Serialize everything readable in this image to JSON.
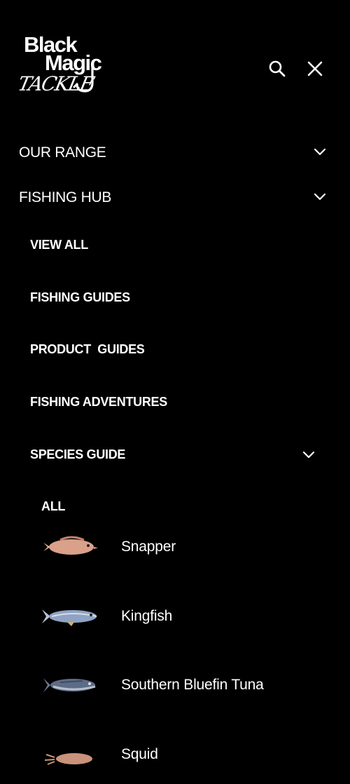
{
  "brand": {
    "line1": "Black",
    "line2": "Magic",
    "line3": "TACKLE"
  },
  "header": {
    "search_icon": "search-icon",
    "close_icon": "close-icon"
  },
  "menu": {
    "our_range": "OUR RANGE",
    "fishing_hub": "FISHING HUB",
    "hub_items": [
      "VIEW ALL",
      "FISHING GUIDES",
      "PRODUCT  GUIDES",
      "FISHING ADVENTURES",
      "SPECIES GUIDE"
    ],
    "species_all": "ALL",
    "species": [
      {
        "name": "Snapper",
        "color": "#d9a08a"
      },
      {
        "name": "Kingfish",
        "color": "#8fa3c4"
      },
      {
        "name": "Southern Bluefin Tuna",
        "color": "#5d6c86"
      },
      {
        "name": "Squid",
        "color": "#c9927a"
      }
    ]
  },
  "colors": {
    "background": "#000000",
    "text": "#ffffff"
  }
}
